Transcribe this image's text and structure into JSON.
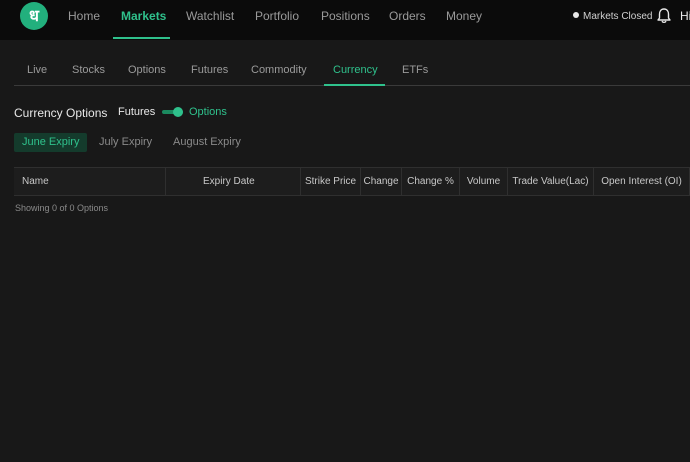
{
  "brand": {
    "logo_glyph": "ध",
    "color": "#22b07d"
  },
  "nav": {
    "items": [
      "Home",
      "Markets",
      "Watchlist",
      "Portfolio",
      "Positions",
      "Orders",
      "Money"
    ],
    "active": "Markets"
  },
  "status": {
    "label": "Markets Closed",
    "icon": "status-dot-icon"
  },
  "notifications": {
    "icon": "bell-icon"
  },
  "greeting": "Hi",
  "subtabs": {
    "items": [
      "Live",
      "Stocks",
      "Options",
      "Futures",
      "Commodity",
      "Currency",
      "ETFs"
    ],
    "active": "Currency"
  },
  "section": {
    "title": "Currency Options",
    "toggle_left": "Futures",
    "toggle_right": "Options",
    "toggle_state": "Options"
  },
  "expiry": {
    "items": [
      "June Expiry",
      "July Expiry",
      "August Expiry"
    ],
    "active": "June Expiry"
  },
  "table": {
    "columns": [
      "Name",
      "Expiry Date",
      "Strike Price",
      "Change",
      "Change %",
      "Volume",
      "Trade Value(Lac)",
      "Open Interest (OI)"
    ],
    "rows": []
  },
  "footer_text": "Showing 0 of 0 Options",
  "colors": {
    "accent": "#2fc18c",
    "background": "#181818",
    "topbar": "#0b0b0b"
  }
}
